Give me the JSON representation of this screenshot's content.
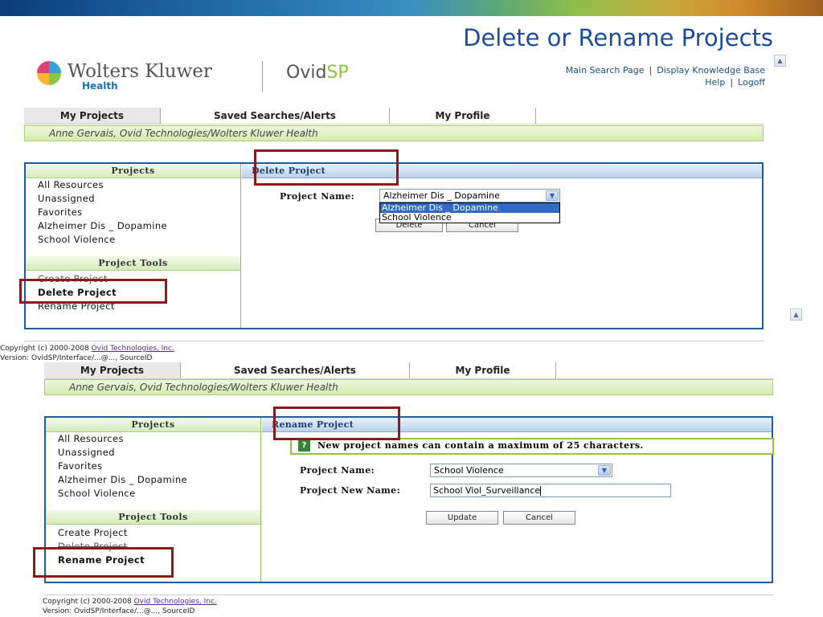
{
  "slide": {
    "title": "Delete or Rename Projects"
  },
  "logo": {
    "brand": "Wolters Kluwer",
    "tm": "TM",
    "sub": "Health",
    "product_a": "Ovid",
    "product_b": "SP"
  },
  "top_links": {
    "main_search": "Main Search Page",
    "display_knowledge_base": "Display Knowledge Base",
    "help": "Help",
    "logoff": "Logoff",
    "sep": "|"
  },
  "tabs": [
    "My Projects",
    "Saved Searches/Alerts",
    "My Profile"
  ],
  "user_line": "Anne Gervais, Ovid Technologies/Wolters Kluwer Health",
  "sidebar": {
    "projects_heading": "Projects",
    "projects": [
      "All Resources",
      "Unassigned",
      "Favorites",
      "Alzheimer Dis _ Dopamine",
      "School Violence"
    ],
    "tools_heading": "Project Tools",
    "tools": [
      "Create Project",
      "Delete Project",
      "Rename Project"
    ]
  },
  "delete_panel": {
    "heading": "Delete Project",
    "project_name_label": "Project Name:",
    "selected": "Alzheimer Dis _ Dopamine",
    "options": [
      "Alzheimer Dis _ Dopamine",
      "School Violence"
    ],
    "delete_button": "Delete",
    "cancel_button": "Cancel"
  },
  "rename_panel": {
    "heading": "Rename Project",
    "info": "New project names can contain a maximum of 25 characters.",
    "info_icon": "?",
    "project_name_label": "Project Name:",
    "selected": "School Violence",
    "new_name_label": "Project New Name:",
    "new_name_value": "School Viol_Surveillance",
    "update_button": "Update",
    "cancel_button": "Cancel"
  },
  "footer": {
    "copyright_prefix": "Copyright (c) 2000-2008 ",
    "copyright_link": "Ovid Technologies, Inc.",
    "version": "Version: OvidSP/Interface/...@..., SourceID"
  },
  "icons": {
    "dropdown": "chevron-down-icon",
    "scroll": "scroll-up-icon",
    "globe": "globe-logo-icon"
  }
}
